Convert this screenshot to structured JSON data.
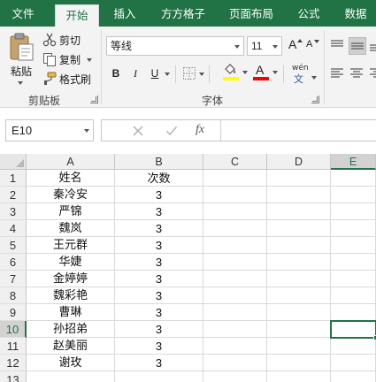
{
  "tabs": [
    {
      "label": "文件",
      "active": false
    },
    {
      "label": "开始",
      "active": true
    },
    {
      "label": "插入",
      "active": false
    },
    {
      "label": "方方格子",
      "active": false
    },
    {
      "label": "页面布局",
      "active": false
    },
    {
      "label": "公式",
      "active": false
    },
    {
      "label": "数据",
      "active": false
    }
  ],
  "ribbon": {
    "clipboard": {
      "paste_label": "粘贴",
      "cut_label": "剪切",
      "copy_label": "复制",
      "format_painter_label": "格式刷",
      "group_label": "剪贴板"
    },
    "font": {
      "font_name": "等线",
      "font_size": "11",
      "bold": "B",
      "italic": "I",
      "underline": "U",
      "font_color_glyph": "A",
      "phonetic_glyph": "wén",
      "phonetic_sub": "文",
      "grow_glyph": "A",
      "shrink_glyph": "A",
      "group_label": "字体",
      "highlight_color": "#ffff00",
      "font_color": "#ff0000"
    }
  },
  "formula_bar": {
    "name_box": "E10",
    "formula": ""
  },
  "grid": {
    "columns": [
      "A",
      "B",
      "C",
      "D",
      "E"
    ],
    "selected_column": "E",
    "selected_row": "10",
    "row_numbers": [
      "1",
      "2",
      "3",
      "4",
      "5",
      "6",
      "7",
      "8",
      "9",
      "10",
      "11",
      "12",
      "13"
    ],
    "rows": [
      [
        "姓名",
        "次数"
      ],
      [
        "秦冷安",
        "3"
      ],
      [
        "严锦",
        "3"
      ],
      [
        "魏岚",
        "3"
      ],
      [
        "王元群",
        "3"
      ],
      [
        "华婕",
        "3"
      ],
      [
        "金婷婷",
        "3"
      ],
      [
        "魏彩艳",
        "3"
      ],
      [
        "曹琳",
        "3"
      ],
      [
        "孙招弟",
        "3"
      ],
      [
        "赵美丽",
        "3"
      ],
      [
        "谢玫",
        "3"
      ],
      [
        "",
        ""
      ]
    ]
  },
  "colors": {
    "accent": "#217346",
    "ribbon_bg": "#f3f3f3",
    "header_bg": "#f0f0f0"
  }
}
